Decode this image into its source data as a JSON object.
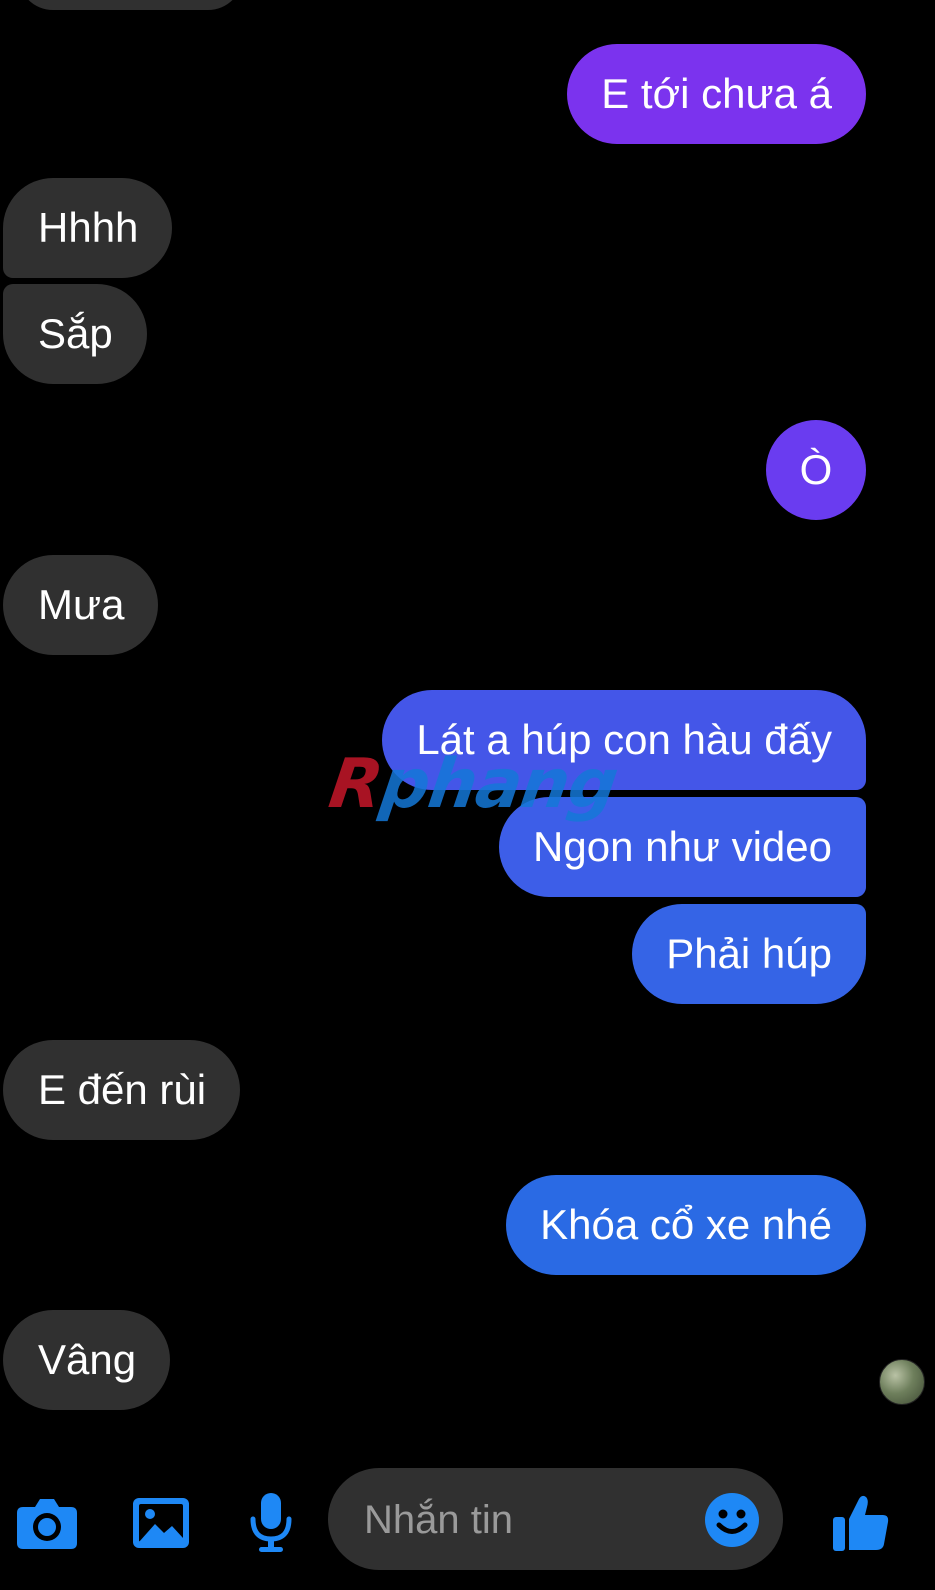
{
  "conversation": {
    "messages": [
      {
        "side": "in",
        "text": "Hhhh"
      },
      {
        "side": "in",
        "text": "Sắp"
      },
      {
        "side": "out",
        "text": "E tới chưa á"
      },
      {
        "side": "out",
        "text": "Ò"
      },
      {
        "side": "in",
        "text": "Mưa"
      },
      {
        "side": "out",
        "text": "Lát a húp con hàu đấy"
      },
      {
        "side": "out",
        "text": "Ngon như video"
      },
      {
        "side": "out",
        "text": "Phải húp"
      },
      {
        "side": "in",
        "text": "E đến rùi"
      },
      {
        "side": "out",
        "text": "Khóa cổ xe nhé"
      },
      {
        "side": "in",
        "text": "Vâng"
      }
    ]
  },
  "watermark": {
    "part1": "R",
    "part2": "phang"
  },
  "composer": {
    "placeholder": "Nhắn tin",
    "value": "",
    "icons": [
      "camera-icon",
      "image-icon",
      "microphone-icon",
      "emoji-icon",
      "thumbs-up-icon"
    ]
  },
  "colors": {
    "incoming_bubble": "#303030",
    "outgoing_top": "#7b33ee",
    "outgoing_middle": "#4359e8",
    "outgoing_bottom": "#2a6ae4",
    "accent": "#1e88f5",
    "background": "#000000"
  }
}
